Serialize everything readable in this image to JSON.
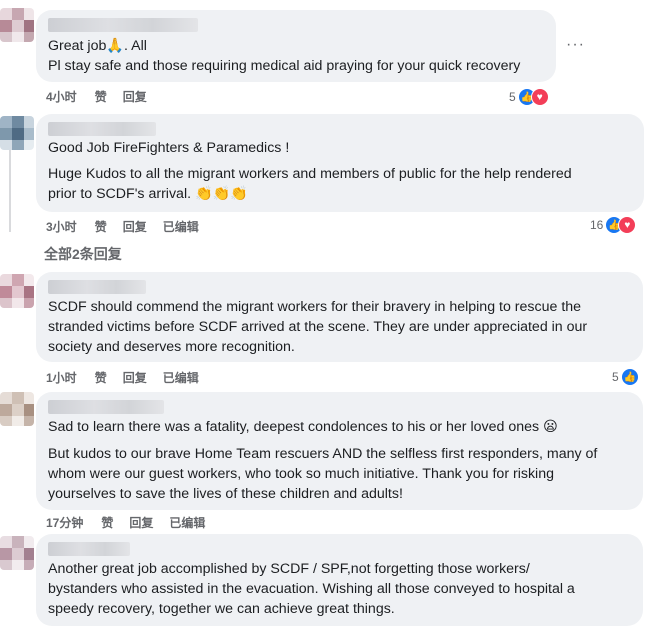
{
  "comments": [
    {
      "text": "Great job🙏. All\nPl stay safe and those requiring medical aid praying for your quick recovery",
      "time": "4小时",
      "like": "赞",
      "reply": "回复",
      "edited": "",
      "reactions": "5"
    },
    {
      "text_1": "Good Job FireFighters & Paramedics !",
      "text_2": "Huge Kudos to all the migrant workers and members of public for the help rendered\nprior to SCDF's arrival. 👏👏👏",
      "time": "3小时",
      "like": "赞",
      "reply": "回复",
      "edited": "已编辑",
      "reactions": "16",
      "view_replies": "全部2条回复"
    },
    {
      "text": "SCDF should commend the migrant workers for their bravery in helping to rescue the\nstranded victims before SCDF arrived at the scene. They are under appreciated in our\nsociety and deserves more recognition.",
      "time": "1小时",
      "like": "赞",
      "reply": "回复",
      "edited": "已编辑",
      "reactions": "5"
    },
    {
      "text_1": "Sad to learn there was a fatality, deepest condolences to his or her loved ones 😦",
      "text_2": "But kudos to our brave Home Team rescuers AND the selfless first responders, many of\nwhom were our guest workers, who took so much initiative. Thank you for risking\nyourselves to save the lives of these children and adults!",
      "time": "17分钟",
      "like": "赞",
      "reply": "回复",
      "edited": "已编辑"
    },
    {
      "text": "Another great job accomplished by SCDF / SPF,not forgetting those workers/\nbystanders who assisted in the evacuation. Wishing all those conveyed to hospital a\nspeedy recovery, together we can achieve great things."
    }
  ],
  "icons": {
    "like": "thumbs-up-icon",
    "love": "heart-icon",
    "more": "more-dots-icon"
  },
  "colors": {
    "like": "#1877f2",
    "love": "#f33e58",
    "bubble": "#eff1f4",
    "meta": "#65676b"
  }
}
